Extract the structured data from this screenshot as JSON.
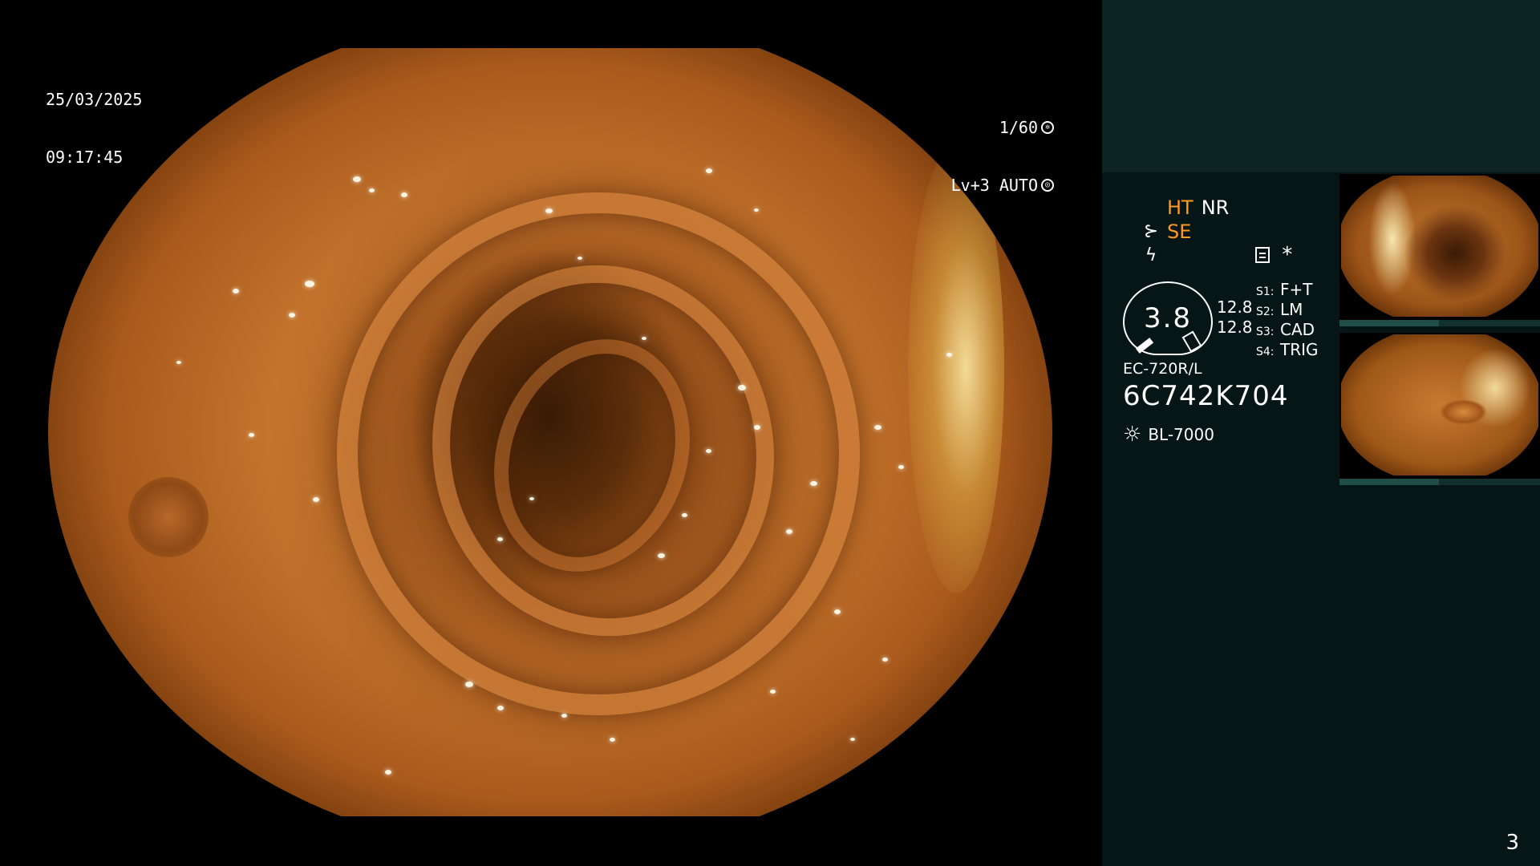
{
  "overlay": {
    "date": "25/03/2025",
    "time": "09:17:45",
    "shutter_speed": "1/60",
    "level_mode": "Lv+3 AUTO"
  },
  "panel": {
    "mode_ht": "HT",
    "mode_nr": "NR",
    "mode_se": "SE",
    "gauge_value": "3.8",
    "gauge_readout_1": "12.8",
    "gauge_readout_2": "12.8",
    "switches": [
      {
        "key": "S1:",
        "value": "F+T"
      },
      {
        "key": "S2:",
        "value": "LM"
      },
      {
        "key": "S3:",
        "value": "CAD"
      },
      {
        "key": "S4:",
        "value": "TRIG"
      }
    ],
    "asterisk": "*",
    "scope_model": "EC-720R/L",
    "serial_number": "6C742K704",
    "light_source": "BL-7000"
  },
  "page_number": "3",
  "colors": {
    "accent_orange": "#ff9a1e",
    "panel_top": "#0c2424",
    "panel_bottom": "#061515"
  },
  "icons": [
    "shutter-icon",
    "iris-icon",
    "scope-tip-icon",
    "lightning-icon",
    "doc-icon",
    "sun-icon"
  ]
}
